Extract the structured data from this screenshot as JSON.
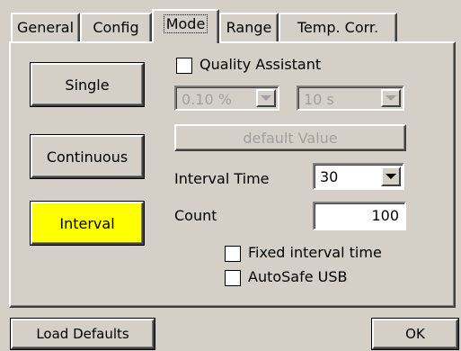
{
  "tabs": [
    {
      "label": "General"
    },
    {
      "label": "Config"
    },
    {
      "label": "Mode"
    },
    {
      "label": "Range"
    },
    {
      "label": "Temp. Corr."
    }
  ],
  "active_tab": "Mode",
  "mode_buttons": {
    "single": "Single",
    "continuous": "Continuous",
    "interval": "Interval",
    "selected": "Interval",
    "selected_color": "#ffff00"
  },
  "quality_assistant": {
    "label": "Quality Assistant",
    "checked": false,
    "tolerance_value": "0.10 %",
    "time_value": "10 s",
    "default_button": "default Value"
  },
  "interval_time": {
    "label": "Interval Time",
    "value": "30"
  },
  "count": {
    "label": "Count",
    "value": "100"
  },
  "options": {
    "fixed_interval_label": "Fixed interval time",
    "fixed_interval_checked": false,
    "autosafe_label": "AutoSafe USB",
    "autosafe_checked": false
  },
  "footer": {
    "load_defaults": "Load Defaults",
    "ok": "OK"
  }
}
